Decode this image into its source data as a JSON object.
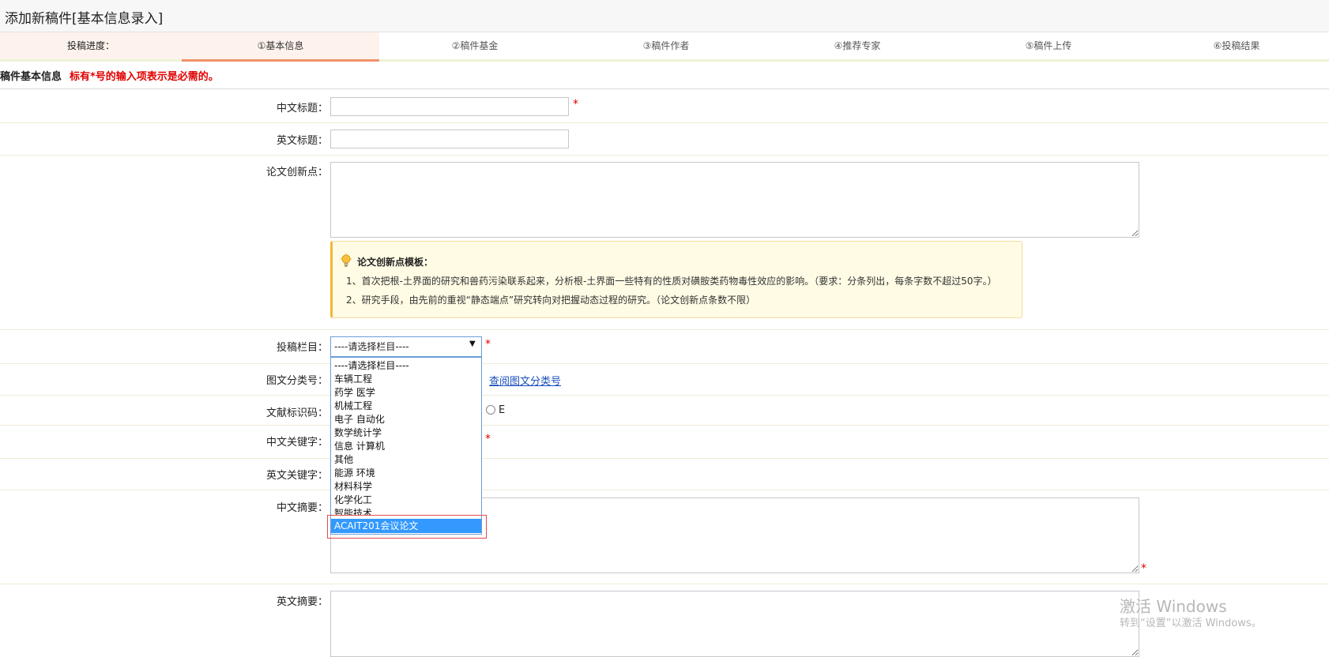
{
  "page": {
    "title": "添加新稿件[基本信息录入]"
  },
  "progress": {
    "label": "投稿进度：",
    "tabs": [
      {
        "label": "①基本信息",
        "active": true
      },
      {
        "label": "②稿件基金",
        "active": false
      },
      {
        "label": "③稿件作者",
        "active": false
      },
      {
        "label": "④推荐专家",
        "active": false
      },
      {
        "label": "⑤稿件上传",
        "active": false
      },
      {
        "label": "⑥投稿结果",
        "active": false
      }
    ]
  },
  "section": {
    "title": "稿件基本信息",
    "note": "标有*号的输入项表示是必需的。"
  },
  "form": {
    "required_mark": "*",
    "cn_title": {
      "label": "中文标题：",
      "value": ""
    },
    "en_title": {
      "label": "英文标题：",
      "value": ""
    },
    "innovation": {
      "label": "论文创新点：",
      "value": ""
    },
    "tip": {
      "title": "论文创新点模板：",
      "lines": [
        "1、首次把根-土界面的研究和兽药污染联系起来，分析根-土界面一些特有的性质对磺胺类药物毒性效应的影响。（要求：分条列出，每条字数不超过50字。）",
        "2、研究手段，由先前的重视“静态端点”研究转向对把握动态过程的研究。（论文创新点条数不限）"
      ]
    },
    "column": {
      "label": "投稿栏目：",
      "selected": "----请选择栏目----",
      "options": [
        "----请选择栏目----",
        "车辆工程",
        "药学 医学",
        "机械工程",
        "电子 自动化",
        "数学统计学",
        "信息 计算机",
        "其他",
        "能源 环境",
        "材料科学",
        "化学化工",
        "智能技术",
        "ACAIT201会议论文"
      ],
      "highlighted": "ACAIT201会议论文"
    },
    "clc": {
      "label": "图文分类号：",
      "link": "查阅图文分类号"
    },
    "doc_code": {
      "label": "文献标识码：",
      "radio_e": "E"
    },
    "cn_keywords": {
      "label": "中文关键字："
    },
    "en_keywords": {
      "label": "英文关键字："
    },
    "cn_abstract": {
      "label": "中文摘要："
    },
    "en_abstract": {
      "label": "英文摘要："
    }
  },
  "watermark": {
    "line1": "激活 Windows",
    "line2": "转到“设置”以激活 Windows。"
  },
  "colors": {
    "required": "#e00000",
    "link": "#1a4fbf",
    "active_tab_underline": "#f0926a",
    "selected_option": "#3399ff"
  }
}
